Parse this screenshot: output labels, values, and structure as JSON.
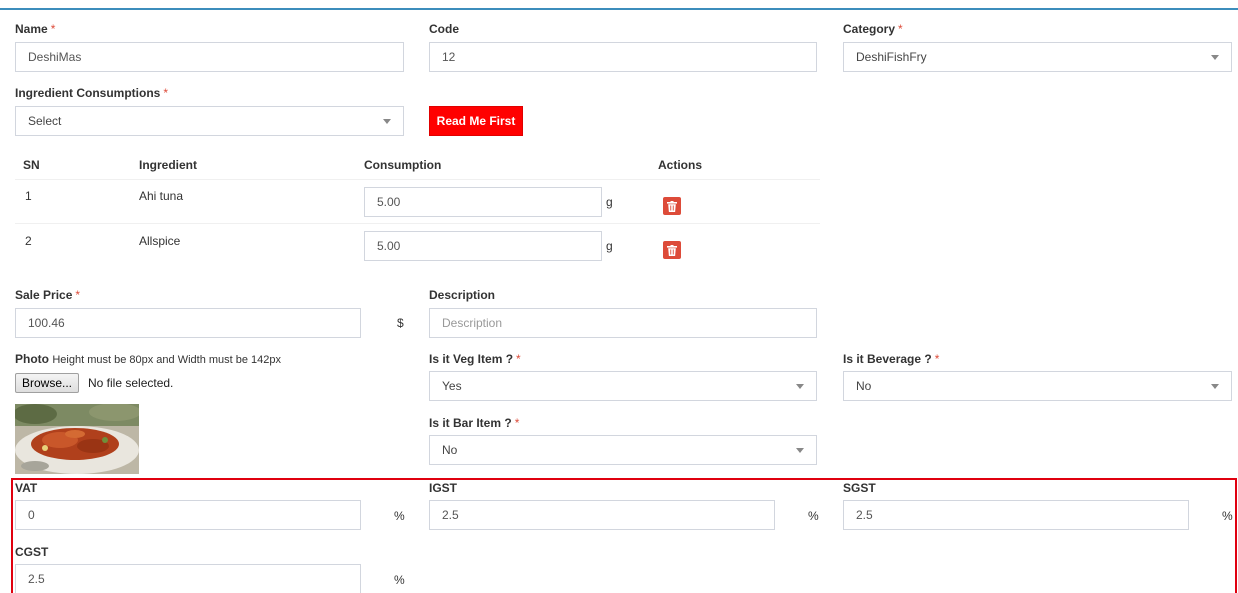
{
  "form": {
    "name": {
      "label": "Name",
      "required": "*",
      "value": "DeshiMas"
    },
    "code": {
      "label": "Code",
      "value": "12"
    },
    "category": {
      "label": "Category",
      "required": "*",
      "value": "DeshiFishFry"
    },
    "ingredient_consumptions": {
      "label": "Ingredient Consumptions",
      "required": "*",
      "value": "Select"
    },
    "read_me_button": "Read Me First",
    "table": {
      "headers": [
        "SN",
        "Ingredient",
        "Consumption",
        "Actions"
      ],
      "rows": [
        {
          "sn": "1",
          "ingredient": "Ahi tuna",
          "consumption": "5.00",
          "unit": "g"
        },
        {
          "sn": "2",
          "ingredient": "Allspice",
          "consumption": "5.00",
          "unit": "g"
        }
      ]
    },
    "sale_price": {
      "label": "Sale Price",
      "required": "*",
      "value": "100.46",
      "unit": "$"
    },
    "description": {
      "label": "Description",
      "placeholder": "Description"
    },
    "photo": {
      "label": "Photo",
      "hint": "Height must be 80px and Width must be 142px",
      "browse_label": "Browse...",
      "file_status": "No file selected."
    },
    "is_veg": {
      "label": "Is it Veg Item ?",
      "required": "*",
      "value": "Yes"
    },
    "is_beverage": {
      "label": "Is it Beverage ?",
      "required": "*",
      "value": "No"
    },
    "is_bar": {
      "label": "Is it Bar Item ?",
      "required": "*",
      "value": "No"
    },
    "vat": {
      "label": "VAT",
      "value": "0",
      "unit": "%"
    },
    "igst": {
      "label": "IGST",
      "value": "2.5",
      "unit": "%"
    },
    "sgst": {
      "label": "SGST",
      "value": "2.5",
      "unit": "%"
    },
    "cgst": {
      "label": "CGST",
      "value": "2.5",
      "unit": "%"
    }
  },
  "icons": {
    "trash": "trash-icon",
    "caret": "chevron-down-icon"
  },
  "colors": {
    "accent": "#3c8dbc",
    "danger": "#dd4b39",
    "button_red": "#ff0000",
    "highlight_box": "#e0000f"
  }
}
